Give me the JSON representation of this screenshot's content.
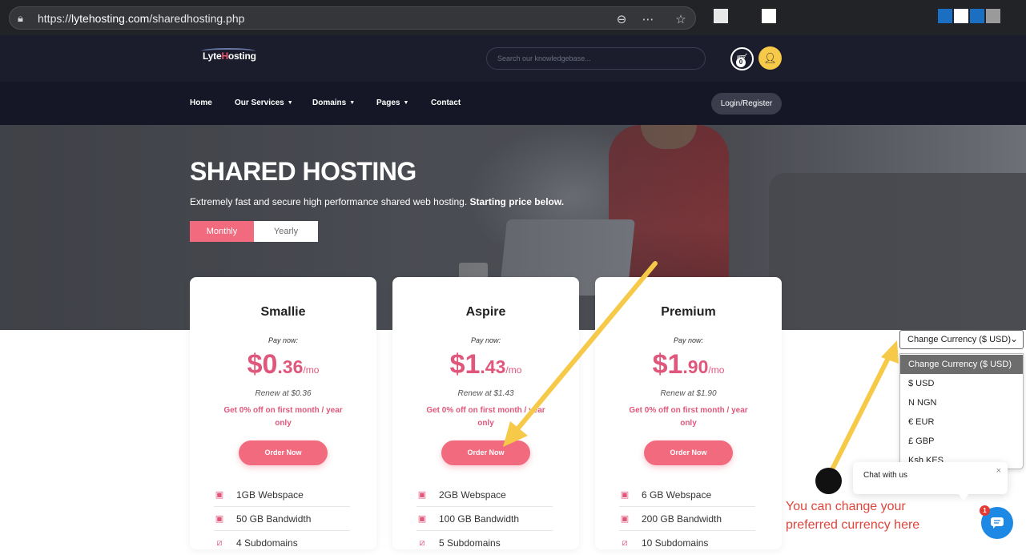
{
  "browser": {
    "url_prefix": "https://",
    "url_host": "lytehosting.com",
    "url_path": "/sharedhosting.php",
    "icons": [
      "lock-icon",
      "zoom-out-icon",
      "more-icon",
      "star-icon"
    ]
  },
  "header": {
    "logo_pre": "Lyte",
    "logo_h": "H",
    "logo_post": "osting",
    "search_placeholder": "Search our knowledgebase...",
    "cart_count": "0"
  },
  "nav": {
    "items": [
      {
        "label": "Home",
        "has_dropdown": false
      },
      {
        "label": "Our Services",
        "has_dropdown": true
      },
      {
        "label": "Domains",
        "has_dropdown": true
      },
      {
        "label": "Pages",
        "has_dropdown": true
      },
      {
        "label": "Contact",
        "has_dropdown": false
      }
    ],
    "login_label": "Login/Register"
  },
  "hero": {
    "title": "SHARED HOSTING",
    "subtitle": "Extremely fast and secure high performance shared web hosting.",
    "subtitle_bold": "Starting price below.",
    "toggle_monthly": "Monthly",
    "toggle_yearly": "Yearly"
  },
  "plans": [
    {
      "name": "Smallie",
      "pay_now": "Pay now:",
      "price_big": "$0",
      "price_cents": ".36",
      "price_per": "/mo",
      "renew": "Renew at $0.36",
      "promo": "Get 0% off on first month / year only",
      "order": "Order Now",
      "features": [
        "1GB Webspace",
        "50 GB Bandwidth",
        "4 Subdomains"
      ]
    },
    {
      "name": "Aspire",
      "pay_now": "Pay now:",
      "price_big": "$1",
      "price_cents": ".43",
      "price_per": "/mo",
      "renew": "Renew at $1.43",
      "promo": "Get 0% off on first month / year only",
      "order": "Order Now",
      "features": [
        "2GB Webspace",
        "100 GB Bandwidth",
        "5 Subdomains"
      ]
    },
    {
      "name": "Premium",
      "pay_now": "Pay now:",
      "price_big": "$1",
      "price_cents": ".90",
      "price_per": "/mo",
      "renew": "Renew at $1.90",
      "promo": "Get 0% off on first month / year only",
      "order": "Order Now",
      "features": [
        "6 GB Webspace",
        "200 GB Bandwidth",
        "10 Subdomains"
      ]
    }
  ],
  "currency": {
    "selected": "Change Currency ($ USD)",
    "options": [
      "Change Currency ($ USD)",
      "$ USD",
      "N NGN",
      "€ EUR",
      "£ GBP",
      "Ksh KES"
    ]
  },
  "annotation": {
    "line1": "You can change your",
    "line2": "preferred currency here",
    "color": "#e0453c",
    "arrow_color": "#f7c948"
  },
  "chat": {
    "label": "Chat with us",
    "close": "×",
    "badge": "1"
  },
  "colors": {
    "accent": "#f26a7e",
    "price": "#e0577c",
    "header_bg": "#1b1d2c",
    "nav_bg": "#151726"
  }
}
